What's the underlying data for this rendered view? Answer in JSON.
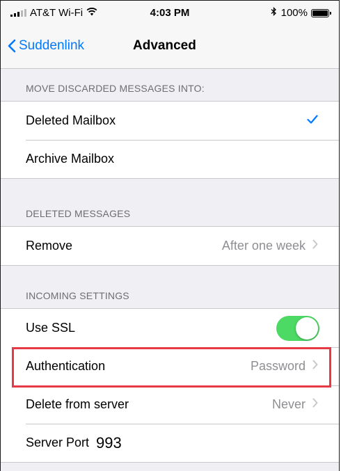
{
  "status_bar": {
    "carrier": "AT&T Wi-Fi",
    "time": "4:03 PM",
    "battery": "100%"
  },
  "nav": {
    "back_label": "Suddenlink",
    "title": "Advanced"
  },
  "sections": {
    "move_discarded": {
      "header": "MOVE DISCARDED MESSAGES INTO:",
      "deleted_mailbox": "Deleted Mailbox",
      "archive_mailbox": "Archive Mailbox"
    },
    "deleted_messages": {
      "header": "DELETED MESSAGES",
      "remove_label": "Remove",
      "remove_value": "After one week"
    },
    "incoming": {
      "header": "INCOMING SETTINGS",
      "ssl_label": "Use SSL",
      "ssl_on": true,
      "auth_label": "Authentication",
      "auth_value": "Password",
      "delete_label": "Delete from server",
      "delete_value": "Never",
      "port_label": "Server Port",
      "port_value": "993"
    }
  },
  "colors": {
    "accent": "#007aff",
    "toggle_on": "#4cd964",
    "highlight": "#e63946"
  }
}
